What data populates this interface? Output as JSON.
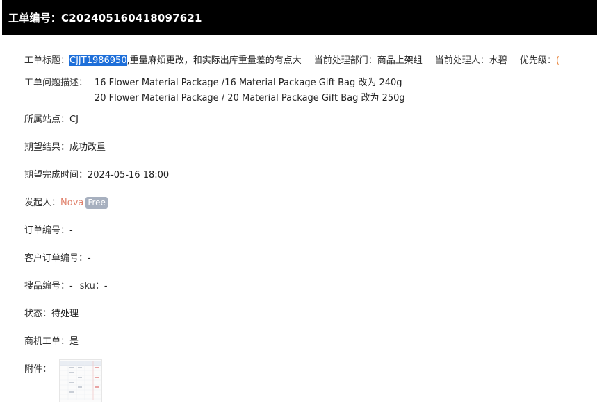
{
  "header": {
    "title": "工单编号：C202405160418097621"
  },
  "ticket": {
    "title_label": "工单标题：",
    "title_selected": "CJJT1986950",
    "title_rest": ",重量麻烦更改，和实际出库重量差的有点大",
    "dept_label": "当前处理部门：",
    "dept_value": "商品上架组",
    "handler_label": "当前处理人：",
    "handler_value": "水碧",
    "priority_label": "优先级：",
    "priority_value": "(",
    "desc_label": "工单问题描述：",
    "desc_lines": [
      "16 Flower Material Package   /16 Material Package Gift Bag   改为 240g",
      "20 Flower Material Package / 20 Material Package Gift Bag    改为 250g"
    ],
    "site_label": "所属站点：",
    "site_value": "CJ",
    "expect_label": "期望结果：",
    "expect_value": "成功改重",
    "due_label": "期望完成时间：",
    "due_value": "2024-05-16 18:00",
    "initiator_label": "发起人：",
    "initiator_name": "Nova",
    "initiator_badge": "Free",
    "order_label": "订单编号：",
    "order_value": "-",
    "cust_order_label": "客户订单编号：",
    "cust_order_value": "-",
    "search_label": "搜品编号：",
    "search_value": "-",
    "sku_label": "sku：",
    "sku_value": "-",
    "status_label": "状态：",
    "status_value": "待处理",
    "biz_label": "商机工单：",
    "biz_value": "是",
    "attach_label": "附件："
  },
  "colors": {
    "header_bg": "#000000",
    "selection": "#1e6fd9",
    "initiator": "#e0806a",
    "badge_bg": "#a7b0bf",
    "priority": "#e8833a"
  }
}
